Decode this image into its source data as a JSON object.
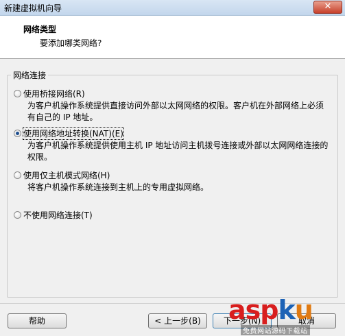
{
  "window": {
    "title": "新建虚拟机向导",
    "close_icon": "close-icon"
  },
  "header": {
    "title": "网络类型",
    "subtitle": "要添加哪类网络?"
  },
  "group": {
    "label": "网络连接",
    "options": [
      {
        "label": "使用桥接网络(R)",
        "selected": false,
        "description": "为客户机操作系统提供直接访问外部以太网网络的权限。客户机在外部网络上必须有自己的 IP 地址。"
      },
      {
        "label": "使用网络地址转换(NAT)(E)",
        "selected": true,
        "description": "为客户机操作系统提供使用主机 IP 地址访问主机拨号连接或外部以太网网络连接的权限。"
      },
      {
        "label": "使用仅主机模式网络(H)",
        "selected": false,
        "description": "将客户机操作系统连接到主机上的专用虚拟网络。"
      },
      {
        "label": "不使用网络连接(T)",
        "selected": false,
        "description": ""
      }
    ]
  },
  "footer": {
    "help_label": "帮助",
    "back_label": "< 上一步(B)",
    "next_label": "下一步(N)",
    "cancel_label": "取消"
  },
  "watermark": {
    "brand_a": "asp",
    "brand_b": "k",
    "brand_c": "u",
    "tagline": "免费网站源码下载站"
  }
}
